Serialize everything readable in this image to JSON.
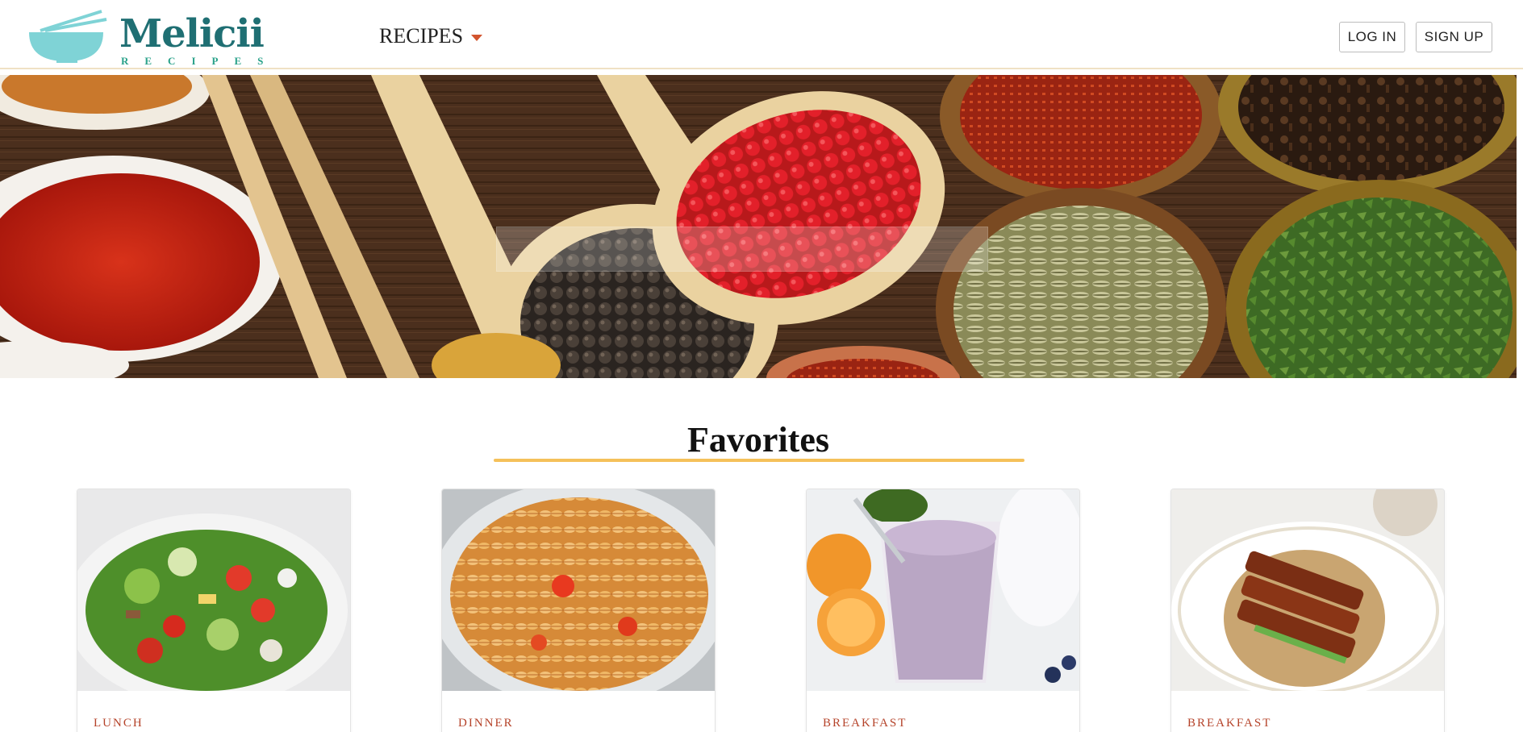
{
  "brand": {
    "name": "Melicii",
    "subtitle": "RECIPES",
    "color": "#1f6f73",
    "accent": "#7fd3d6"
  },
  "nav": {
    "recipes_label": "RECIPES"
  },
  "auth": {
    "login_label": "LOG IN",
    "signup_label": "SIGN UP"
  },
  "hero": {
    "image": "spices-in-wooden-spoons-and-bowls",
    "search_placeholder": ""
  },
  "favorites": {
    "title": "Favorites",
    "underline_color": "#f5c15a",
    "cards": [
      {
        "category": "LUNCH",
        "image": "salad-image"
      },
      {
        "category": "DINNER",
        "image": "pasta-image"
      },
      {
        "category": "BREAKFAST",
        "image": "smoothie-image"
      },
      {
        "category": "BREAKFAST",
        "image": "tempeh-sandwich-image"
      }
    ]
  }
}
